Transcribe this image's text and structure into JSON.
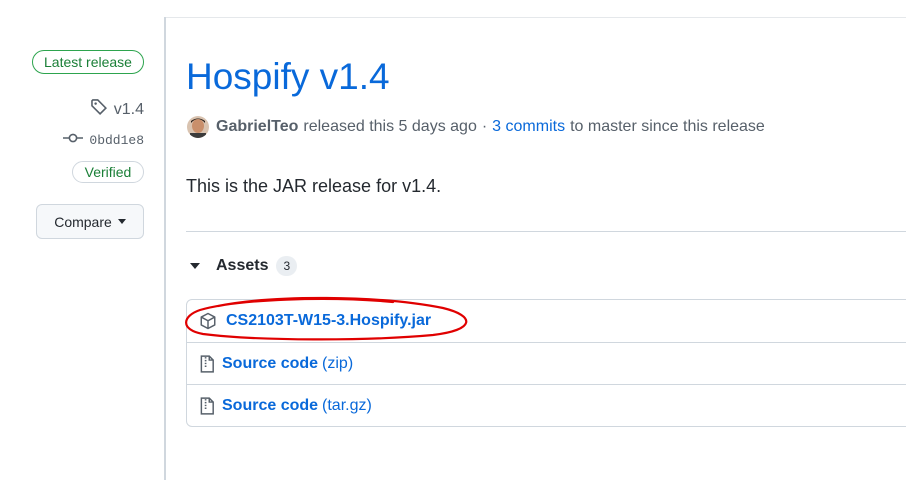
{
  "sidebar": {
    "latest_badge": "Latest release",
    "tag": "v1.4",
    "commit": "0bdd1e8",
    "verified": "Verified",
    "compare_label": "Compare"
  },
  "release": {
    "title": "Hospify v1.4",
    "author": "GabrielTeo",
    "released_text": "released this 5 days ago",
    "separator": "·",
    "commits_link": "3 commits",
    "commits_suffix": "to master since this release",
    "body": "This is the JAR release for v1.4."
  },
  "assets": {
    "label": "Assets",
    "count": "3",
    "items": [
      {
        "name": "CS2103T-W15-3.Hospify.jar",
        "suffix": "",
        "icon": "package-icon"
      },
      {
        "name": "Source code",
        "suffix": "(zip)",
        "icon": "file-zip-icon"
      },
      {
        "name": "Source code",
        "suffix": "(tar.gz)",
        "icon": "file-zip-icon"
      }
    ]
  },
  "colors": {
    "link": "#0969da",
    "verified_green": "#1a7f37",
    "annotation_red": "#e00000"
  }
}
